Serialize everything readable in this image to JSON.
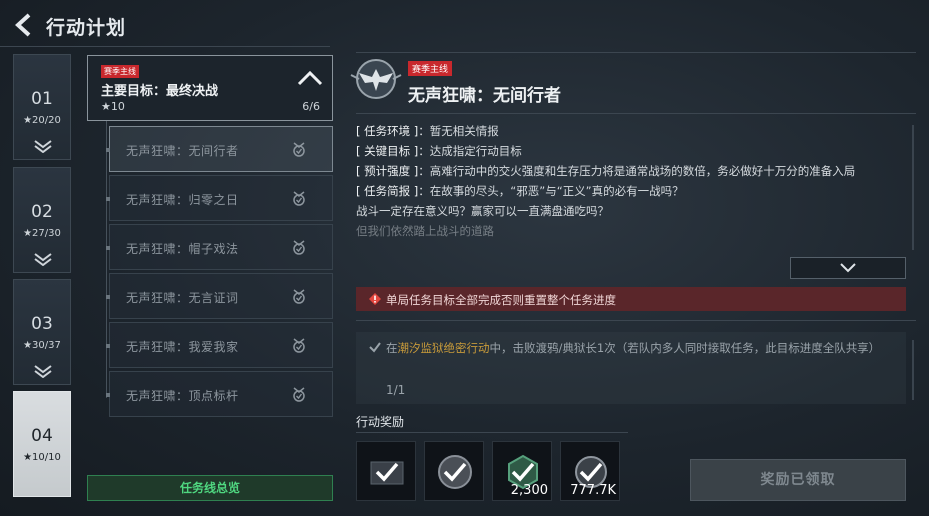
{
  "header": {
    "title": "行动计划",
    "back_icon": "back-arrow-icon"
  },
  "chapters": [
    {
      "number": "01",
      "stars": "★20/20",
      "active": false
    },
    {
      "number": "02",
      "stars": "★27/30",
      "active": false
    },
    {
      "number": "03",
      "stars": "★30/37",
      "active": false
    },
    {
      "number": "04",
      "stars": "★10/10",
      "active": true
    }
  ],
  "main_goal": {
    "tag": "赛季主线",
    "title": "主要目标：最终决战",
    "stars": "★10",
    "progress": "6/6"
  },
  "sub_missions": [
    {
      "label": "无声狂啸：无间行者",
      "selected": true
    },
    {
      "label": "无声狂啸：归零之日",
      "selected": false
    },
    {
      "label": "无声狂啸：帽子戏法",
      "selected": false
    },
    {
      "label": "无声狂啸：无言证词",
      "selected": false
    },
    {
      "label": "无声狂啸：我爱我家",
      "selected": false
    },
    {
      "label": "无声狂啸：顶点标杆",
      "selected": false
    }
  ],
  "overview_button": "任务线总览",
  "detail": {
    "tag": "赛季主线",
    "title": "无声狂啸：无间行者",
    "environment_key": "[ 任务环境 ]",
    "environment": "：暂无相关情报",
    "key_target_key": "[ 关键目标 ]",
    "key_target": "：达成指定行动目标",
    "intensity_key": "[ 预计强度 ]",
    "intensity": "：高难行动中的交火强度和生存压力将是通常战场的数倍，务必做好十万分的准备入局",
    "brief_key": "[ 任务简报 ]",
    "brief_1": "：在故事的尽头，“邪恶”与“正义”真的必有一战吗？",
    "brief_2": "战斗一定存在意义吗？赢家可以一直满盘通吃吗？",
    "brief_3": "但我们依然踏上战斗的道路"
  },
  "warning": "单局任务目标全部完成否则重置整个任务进度",
  "objective": {
    "prefix": "在",
    "highlight": "潮汐监狱绝密行动",
    "suffix": "中，击败渡鸦/典狱长1次（若队内多人同时接取任务，此目标进度全队共享）",
    "progress": "1/1",
    "completed": true
  },
  "rewards": {
    "label": "行动奖励",
    "items": [
      {
        "name": "reward-1",
        "qty": ""
      },
      {
        "name": "reward-2",
        "qty": ""
      },
      {
        "name": "reward-3",
        "qty": "2,300"
      },
      {
        "name": "reward-4",
        "qty": "777.7K"
      }
    ],
    "claimed_button": "奖励已领取"
  },
  "colors": {
    "accent_green": "#4fd780",
    "tag_red": "#c8282d",
    "warn_bg": "#5a262a",
    "highlight": "#c79a3a"
  }
}
